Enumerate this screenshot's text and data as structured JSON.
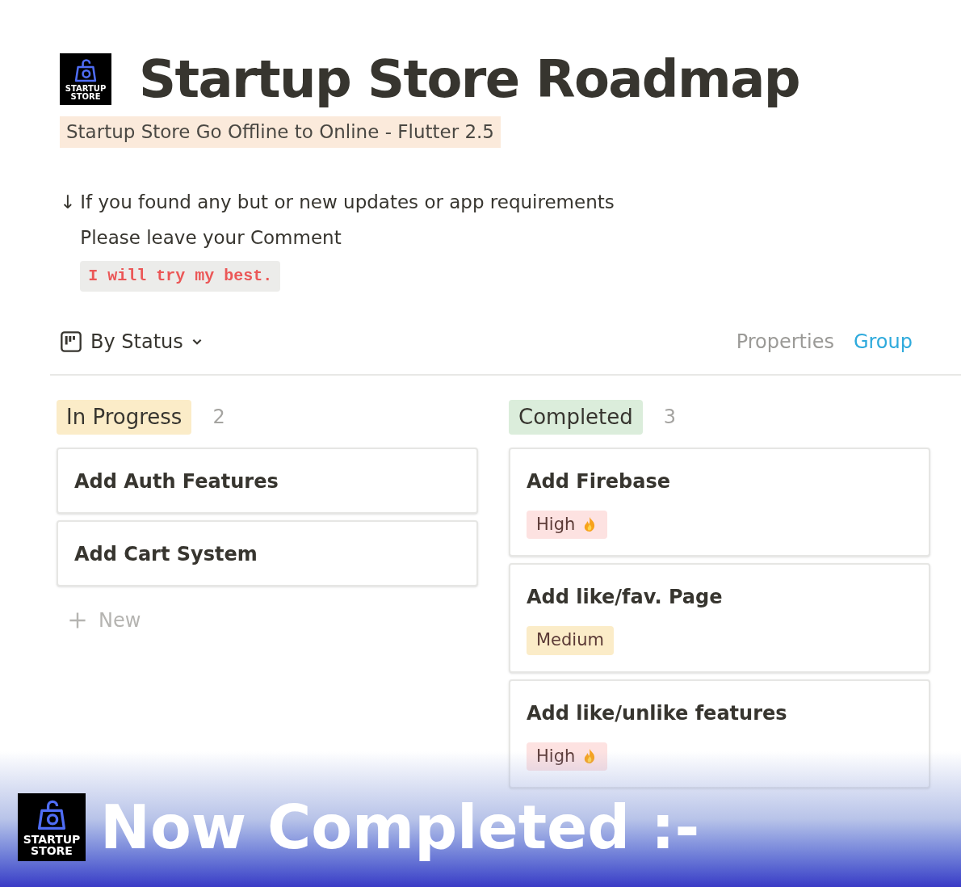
{
  "page": {
    "logo_lines": [
      "STARTUP",
      "STORE"
    ],
    "title": "Startup Store Roadmap",
    "subtitle": "Startup Store Go Offline to Online - Flutter 2.5"
  },
  "note": {
    "arrow": "↓",
    "lines": [
      "If you found any but or new updates or app requirements",
      "Please leave your Comment"
    ],
    "code": "I will try my best."
  },
  "board": {
    "view": "By Status",
    "actions": [
      {
        "label": "Properties",
        "selected": false
      },
      {
        "label": "Group",
        "selected": true
      }
    ],
    "columns": [
      {
        "title": "In Progress",
        "color": "#fbecc8",
        "count": "2",
        "cards": [
          {
            "title": "Add Auth Features"
          },
          {
            "title": "Add Cart System"
          }
        ],
        "new_label": "New"
      },
      {
        "title": "Completed",
        "color": "#dbeddb",
        "count": "3",
        "cards": [
          {
            "title": "Add Firebase",
            "tag": {
              "label": "High",
              "color": "#fde2e1",
              "fire": true
            }
          },
          {
            "title": "Add like/fav. Page",
            "tag": {
              "label": "Medium",
              "color": "#fbecc8",
              "fire": false
            }
          },
          {
            "title": "Add like/unlike features",
            "tag": {
              "label": "High",
              "color": "#fde2e1",
              "fire": true
            }
          }
        ]
      }
    ]
  },
  "banner": {
    "logo_lines": [
      "STARTUP",
      "STORE"
    ],
    "text": "Now Completed :-"
  }
}
